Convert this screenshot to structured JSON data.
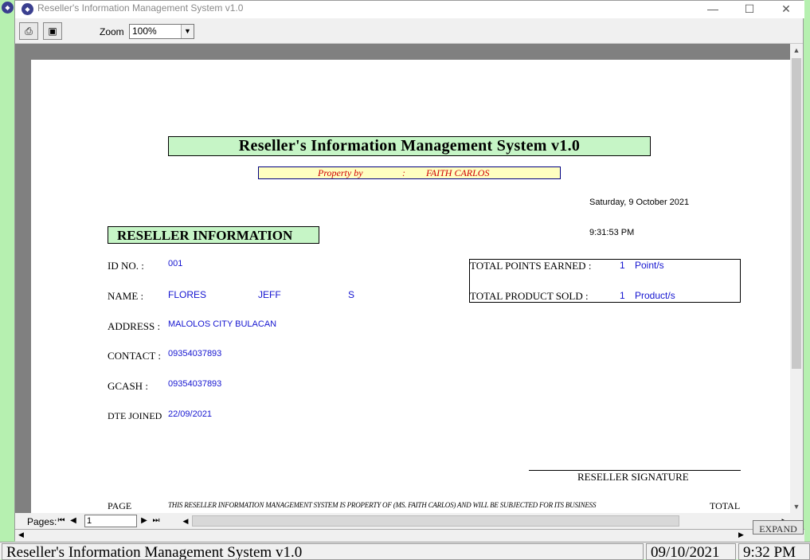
{
  "window": {
    "title": "Reseller's Information Management System v1.0",
    "app_icon": "app-icon",
    "controls": {
      "minimize": "—",
      "maximize": "☐",
      "close": "✕"
    }
  },
  "toolbar": {
    "print_icon": "printer-icon",
    "export_icon": "export-icon",
    "zoom_label": "Zoom",
    "zoom_value": "100%"
  },
  "report": {
    "title": "Reseller's Information Management System v1.0",
    "property_label": "Property by",
    "property_sep": ":",
    "property_owner": "FAITH CARLOS",
    "date": "Saturday, 9 October 2021",
    "time": "9:31:53 PM",
    "section_title": "RESELLER INFORMATION",
    "fields": {
      "id_label": "ID NO. :",
      "id_value": "001",
      "name_label": "NAME :",
      "last_name": "FLORES",
      "first_name": "JEFF",
      "middle_initial": "S",
      "address_label": "ADDRESS :",
      "address_value": "MALOLOS CITY BULACAN",
      "contact_label": "CONTACT :",
      "contact_value": "09354037893",
      "gcash_label": "GCASH :",
      "gcash_value": "09354037893",
      "joined_label": "DTE JOINED",
      "joined_value": "22/09/2021"
    },
    "totals": {
      "points_label": "TOTAL POINTS EARNED :",
      "points_value": "1",
      "points_unit": "Point/s",
      "sold_label": "TOTAL PRODUCT SOLD :",
      "sold_value": "1",
      "sold_unit": "Product/s"
    },
    "signature_label": "RESELLER SIGNATURE",
    "footer": {
      "page_label": "PAGE",
      "total_label": "TOTAL",
      "note": "THIS RESELLER INFORMATION MANAGEMENT SYSTEM IS PROPERTY OF (MS. FAITH CARLOS) AND WILL BE SUBJECTED FOR ITS BUSINESS"
    }
  },
  "navigation": {
    "pages_label": "Pages:",
    "page_value": "1"
  },
  "expand_label": "EXPAND",
  "statusbar": {
    "app_name": "Reseller's Information Management System v1.0",
    "date": "09/10/2021",
    "time": "9:32 PM"
  }
}
